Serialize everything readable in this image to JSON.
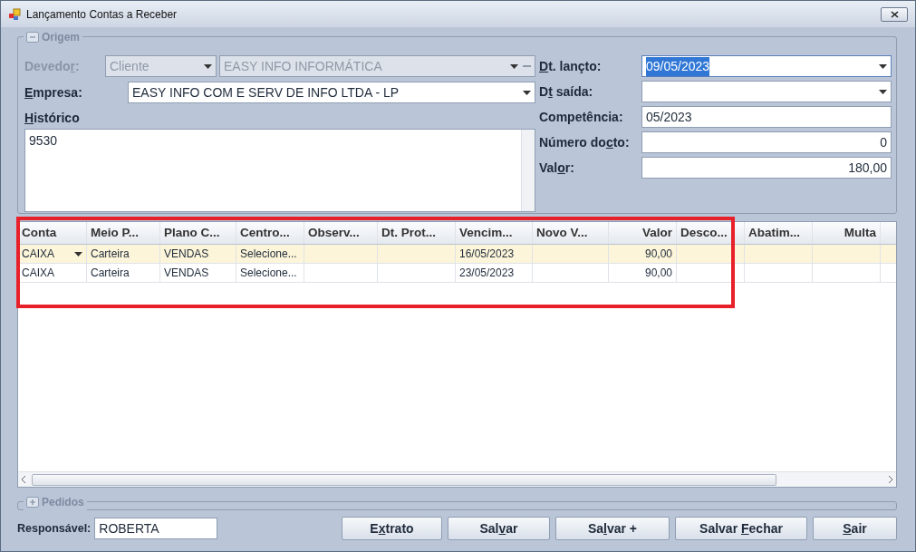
{
  "window": {
    "title": "Lançamento Contas a Receber"
  },
  "origem": {
    "title": "Origem",
    "collapsed": false,
    "devedor": {
      "label_parts": [
        {
          "text": "Devedo",
          "underlined": false
        },
        {
          "text": "r",
          "underlined": true
        },
        {
          "text": ":",
          "underlined": false
        }
      ],
      "type_value": "Cliente",
      "name_value": "EASY INFO INFORMÁTICA",
      "disabled": true
    },
    "empresa": {
      "label_parts": [
        {
          "text": "E",
          "underlined": true
        },
        {
          "text": "mpresa:",
          "underlined": false
        }
      ],
      "value": "EASY INFO COM E SERV DE INFO LTDA - LP"
    },
    "historico": {
      "label_parts": [
        {
          "text": "H",
          "underlined": true
        },
        {
          "text": "istórico",
          "underlined": false
        }
      ],
      "value": "9530"
    },
    "fields": [
      {
        "kind": "date",
        "label_parts": [
          {
            "text": "D",
            "underlined": true
          },
          {
            "text": "t. lançto:",
            "underlined": false
          }
        ],
        "value": "09/05/2023",
        "text_selected": true
      },
      {
        "kind": "date",
        "label_parts": [
          {
            "text": "D",
            "underlined": false
          },
          {
            "text": "t",
            "underlined": true
          },
          {
            "text": " saída:",
            "underlined": false
          }
        ],
        "text_selected": false
      },
      {
        "kind": "text",
        "label_parts": [
          {
            "text": "Competência:",
            "underlined": false
          }
        ],
        "value": "05/2023",
        "text_selected": false
      },
      {
        "kind": "number",
        "label_parts": [
          {
            "text": "Número do",
            "underlined": false
          },
          {
            "text": "c",
            "underlined": true
          },
          {
            "text": "to:",
            "underlined": false
          }
        ],
        "value": "0",
        "text_selected": false
      },
      {
        "kind": "number",
        "label_parts": [
          {
            "text": "Val",
            "underlined": false
          },
          {
            "text": "o",
            "underlined": true
          },
          {
            "text": "r:",
            "underlined": false
          }
        ],
        "value": "180,00",
        "text_selected": false
      }
    ]
  },
  "grid": {
    "columns": [
      {
        "label": "Conta",
        "kind": "text"
      },
      {
        "label": "Meio P...",
        "kind": "text"
      },
      {
        "label": "Plano C...",
        "kind": "text"
      },
      {
        "label": "Centro...",
        "kind": "text"
      },
      {
        "label": "Observ...",
        "kind": "text"
      },
      {
        "label": "Dt. Prot...",
        "kind": "text"
      },
      {
        "label": "Vencim...",
        "kind": "text"
      },
      {
        "label": "Novo V...",
        "kind": "text"
      },
      {
        "label": "Valor",
        "kind": "number"
      },
      {
        "label": "Desco...",
        "kind": "text"
      },
      {
        "label": "Abatim...",
        "kind": "text"
      },
      {
        "label": "Multa",
        "kind": "number"
      }
    ],
    "rows": [
      {
        "selected": true,
        "cells": [
          "CAIXA",
          "Carteira",
          "VENDAS",
          "Selecione...",
          null,
          null,
          "16/05/2023",
          null,
          "90,00",
          null,
          null,
          null
        ]
      },
      {
        "selected": false,
        "cells": [
          "CAIXA",
          "Carteira",
          "VENDAS",
          "Selecione...",
          null,
          null,
          "23/05/2023",
          null,
          "90,00",
          null,
          null,
          null
        ]
      }
    ]
  },
  "highlight": {
    "color": "#e8202a"
  },
  "pedidos": {
    "title": "Pedidos",
    "collapsed": true
  },
  "responsavel": {
    "label": "Responsável:",
    "value": "ROBERTA"
  },
  "buttons": [
    [
      {
        "text": "E",
        "underlined": false
      },
      {
        "text": "x",
        "underlined": true
      },
      {
        "text": "trato",
        "underlined": false
      }
    ],
    [
      {
        "text": "Sal",
        "underlined": false
      },
      {
        "text": "v",
        "underlined": true
      },
      {
        "text": "ar",
        "underlined": false
      }
    ],
    [
      {
        "text": "Sa",
        "underlined": false
      },
      {
        "text": "l",
        "underlined": true
      },
      {
        "text": "var +",
        "underlined": false
      }
    ],
    [
      {
        "text": "Salvar ",
        "underlined": false
      },
      {
        "text": "F",
        "underlined": true
      },
      {
        "text": "echar",
        "underlined": false
      }
    ],
    [
      {
        "text": "S",
        "underlined": true
      },
      {
        "text": "air",
        "underlined": false
      }
    ]
  ]
}
